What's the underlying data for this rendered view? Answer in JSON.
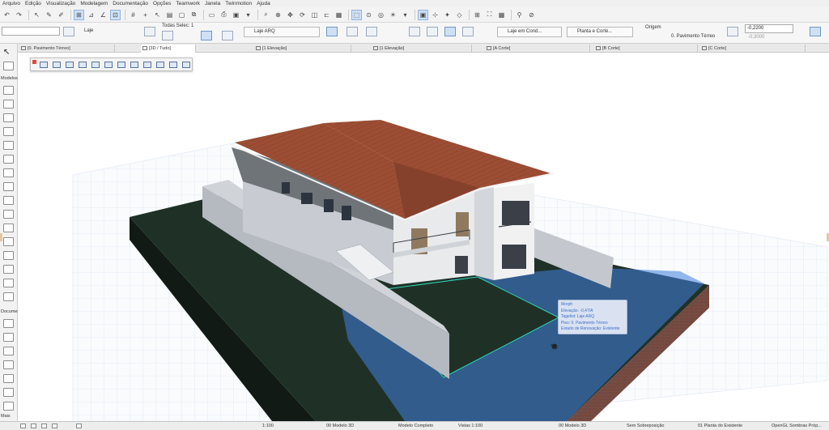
{
  "menu": [
    "Arquivo",
    "Edição",
    "Visualização",
    "Modelagem",
    "Documentação",
    "Opções",
    "Teamwork",
    "Janela",
    "Twinmotion",
    "Ajuda"
  ],
  "infobox": {
    "layer": "Laje",
    "toda_selecionada": "Todas Selec: 1",
    "composite": "Laje ARQ",
    "floor_plan_display": "Laje em Cond...",
    "cut_planes": "Planta e Corte...",
    "origin_label": "Origem",
    "origin_story": "0. Pavimento Térreo",
    "offset_value": "-0,2200",
    "offset_value2": "-0,3000"
  },
  "tabs": [
    {
      "label": "[0. Pavimento Térreo]",
      "active": false
    },
    {
      "label": "[3D / Tudo]",
      "active": true
    },
    {
      "label": "[1 Elevação]",
      "active": false
    },
    {
      "label": "[1 Elevação]",
      "active": false
    },
    {
      "label": "[A Corte]",
      "active": false
    },
    {
      "label": "[B Corte]",
      "active": false
    },
    {
      "label": "[C Corte]",
      "active": false
    }
  ],
  "toolbox": {
    "section_design": "Modelos",
    "section_document": "Documentação",
    "section_more": "Mais"
  },
  "tooltip": {
    "lines": [
      "Morph",
      "Elevação: -0,47/A",
      "Tagelist: Laje ARQ",
      "Piso: 0. Pavimento Térreo",
      "Estado de Renovação: Existente"
    ]
  },
  "statusbar": {
    "scale": "1:100",
    "view_map": "00 Modelo 3D",
    "model_view": "Modelo Completo",
    "display_scale": "Vistas 1:100",
    "view_map2": "00 Modelo 3D",
    "override": "Sem Sobreposição",
    "renovation": "01 Planta do Existente",
    "engine": "OpenGL Sombras Próp..."
  },
  "colors": {
    "roof": "#9c4e34",
    "ground": "#1f3127",
    "brick": "#7a4e44",
    "selection": "#3f7fe0",
    "grid": "#c7d6ea"
  }
}
